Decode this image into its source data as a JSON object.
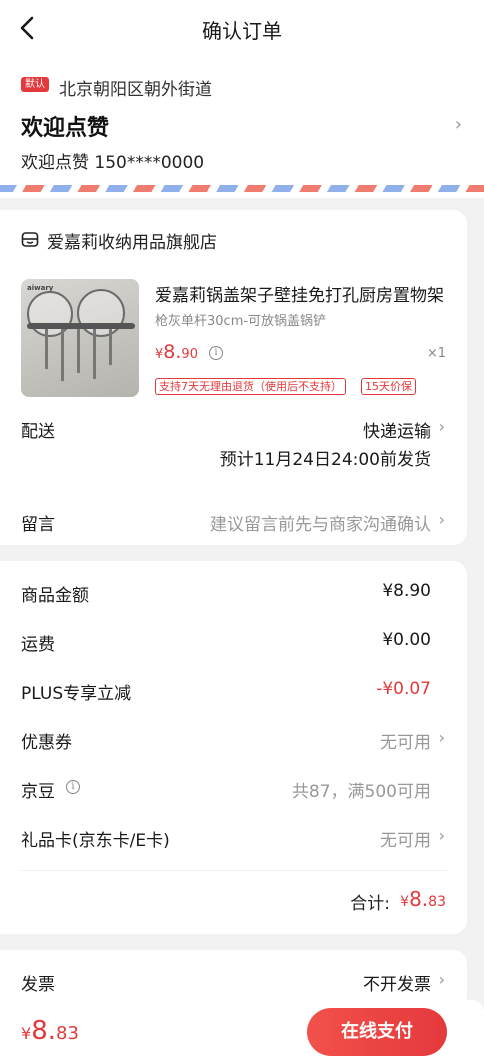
{
  "header": {
    "title": "确认订单"
  },
  "address": {
    "default_tag": "默认",
    "line": "北京朝阳区朝外街道",
    "name": "欢迎点赞",
    "contact": "欢迎点赞 150****0000"
  },
  "shop": {
    "name": "爱嘉莉收纳用品旗舰店"
  },
  "product": {
    "thumb_brand": "aiwary",
    "title": "爱嘉莉锅盖架子壁挂免打孔厨房置物架",
    "spec": "枪灰单杆30cm-可放锅盖锅铲",
    "price_currency": "¥",
    "price_int": "8.",
    "price_dec": "90",
    "info_glyph": "i",
    "qty": "×1",
    "badges": [
      "支持7天无理由退货（使用后不支持）",
      "15天价保"
    ]
  },
  "delivery": {
    "label": "配送",
    "method": "快递运输",
    "eta": "预计11月24日24:00前发货"
  },
  "remark": {
    "label": "留言",
    "placeholder": "建议留言前先与商家沟通确认"
  },
  "summary": {
    "rows": [
      {
        "label": "商品金额",
        "value": "¥8.90"
      },
      {
        "label": "运费",
        "value": "¥0.00"
      },
      {
        "label": "PLUS专享立减",
        "value": "-¥0.07"
      },
      {
        "label": "优惠券",
        "value": "无可用"
      },
      {
        "label": "京豆",
        "value": "共87，满500可用"
      },
      {
        "label": "礼品卡(京东卡/E卡)",
        "value": "无可用"
      }
    ],
    "total_label": "合计:",
    "total_currency": "¥",
    "total_int": "8.",
    "total_dec": "83"
  },
  "invoice": {
    "label": "发票",
    "value": "不开发票"
  },
  "bottom": {
    "price_currency": "¥",
    "price_int": "8.",
    "price_dec": "83",
    "pay_label": "在线支付"
  },
  "colors": {
    "accent": "#e4393c",
    "background": "#f2f2f2"
  }
}
